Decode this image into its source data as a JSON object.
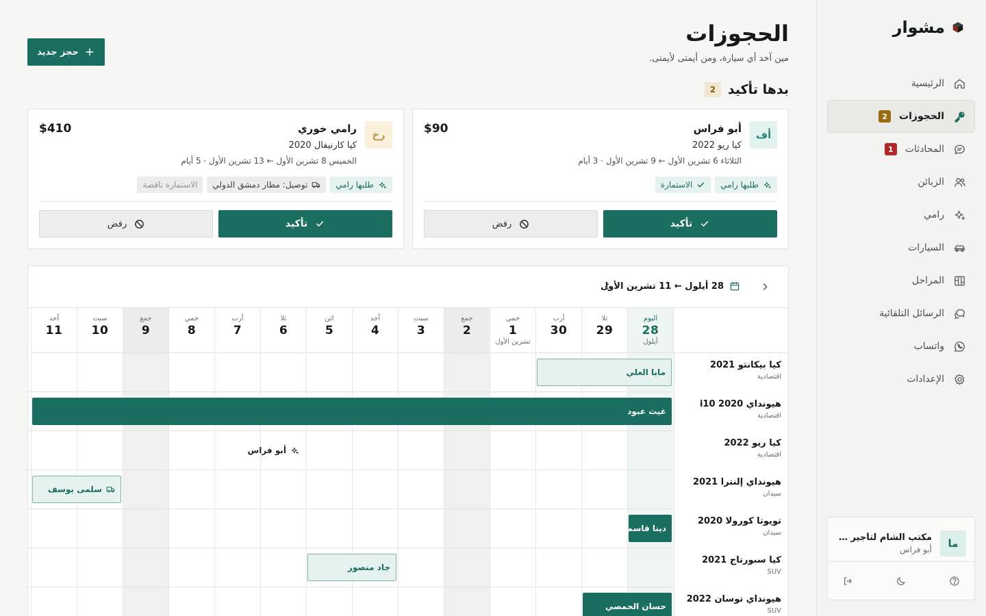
{
  "app": {
    "brand": "مشوار"
  },
  "nav": [
    {
      "label": "الرئيسية",
      "icon": "home-icon"
    },
    {
      "label": "الحجوزات",
      "icon": "key-icon",
      "badge": "2",
      "active": true
    },
    {
      "label": "المحادثات",
      "icon": "chat-icon",
      "badge": "1"
    },
    {
      "label": "الزبائن",
      "icon": "users-icon"
    },
    {
      "label": "رامي",
      "icon": "sparkle-icon"
    },
    {
      "label": "السيارات",
      "icon": "car-icon"
    },
    {
      "label": "المراحل",
      "icon": "kanban-icon"
    },
    {
      "label": "الرسائل التلقائية",
      "icon": "messages-icon"
    },
    {
      "label": "واتساب",
      "icon": "whatsapp-icon"
    },
    {
      "label": "الإعدادات",
      "icon": "gear-icon"
    }
  ],
  "org": {
    "avatar": "ما",
    "name": "مكتب الشام لتأجير السيارات",
    "user": "أبو فراس"
  },
  "page": {
    "title": "الحجوزات",
    "subtitle": "مين آخد أي سيارة، ومن أيمتى لأيمتى.",
    "new_booking": "حجز جديد"
  },
  "pending": {
    "title": "بدها تأكيد",
    "count": "2",
    "cards": [
      {
        "initials": "أف",
        "name": "أبو فراس",
        "car": "كيا ريو 2022",
        "dates": "الثلاثاء 6 تشرين الأول ← 9 تشرين الأول · 3 أيام",
        "price": "$90",
        "tags": [
          {
            "label": "طلبها رامي",
            "icon": "sparkle-icon",
            "style": "teal"
          },
          {
            "label": "الاستمارة",
            "icon": "check-icon",
            "style": "teal"
          }
        ],
        "confirm": "تأكيد",
        "reject": "رفض"
      },
      {
        "initials": "رخ",
        "name": "رامي خوري",
        "car": "كيا كارنيفال 2020",
        "dates": "الخميس 8 تشرين الأول ← 13 تشرين الأول · 5 أيام",
        "price": "$410",
        "tags": [
          {
            "label": "طلبها رامي",
            "icon": "sparkle-icon",
            "style": "teal"
          },
          {
            "label": "توصيل: مطار دمشق الدولي",
            "icon": "truck-icon",
            "style": "gray"
          },
          {
            "label": "الاستمارة ناقصة",
            "icon": "",
            "style": "muted"
          }
        ],
        "confirm": "تأكيد",
        "reject": "رفض"
      }
    ]
  },
  "calendar": {
    "range": "28 أيلول ← 11 تشرين الأول",
    "days": [
      {
        "dn": "اليوم",
        "dd": "28",
        "dm": "أيلول",
        "today": true
      },
      {
        "dn": "ثلا",
        "dd": "29",
        "dm": ""
      },
      {
        "dn": "أرب",
        "dd": "30",
        "dm": ""
      },
      {
        "dn": "خمي",
        "dd": "1",
        "dm": "تشرين الأول"
      },
      {
        "dn": "جمع",
        "dd": "2",
        "dm": "",
        "weekend": true
      },
      {
        "dn": "سبت",
        "dd": "3",
        "dm": ""
      },
      {
        "dn": "أحد",
        "dd": "4",
        "dm": ""
      },
      {
        "dn": "اثن",
        "dd": "5",
        "dm": ""
      },
      {
        "dn": "ثلا",
        "dd": "6",
        "dm": ""
      },
      {
        "dn": "أرب",
        "dd": "7",
        "dm": ""
      },
      {
        "dn": "خمي",
        "dd": "8",
        "dm": ""
      },
      {
        "dn": "جمع",
        "dd": "9",
        "dm": "",
        "weekend": true
      },
      {
        "dn": "سبت",
        "dd": "10",
        "dm": ""
      },
      {
        "dn": "أحد",
        "dd": "11",
        "dm": ""
      }
    ],
    "rows": [
      {
        "car": "كيا بيكانتو 2021",
        "cls": "اقتصادية",
        "bookings": [
          {
            "name": "مايا العلي",
            "start": 0,
            "end": 2,
            "style": "light"
          }
        ]
      },
      {
        "car": "هيونداي i10 2020",
        "cls": "اقتصادية",
        "bookings": [
          {
            "name": "غيث عبود",
            "start": 0,
            "end": 13,
            "style": "solid"
          }
        ]
      },
      {
        "car": "كيا ريو 2022",
        "cls": "اقتصادية",
        "bookings": [
          {
            "name": "أبو فراس",
            "start": 8,
            "end": 10,
            "style": "pending",
            "icon": "sparkle-icon"
          }
        ]
      },
      {
        "car": "هيونداي إلنترا 2021",
        "cls": "سيدان",
        "bookings": [
          {
            "name": "سلمى يوسف",
            "start": 12,
            "end": 13,
            "style": "light",
            "icon": "truck-icon"
          }
        ]
      },
      {
        "car": "تويوتا كورولا 2020",
        "cls": "سيدان",
        "bookings": [
          {
            "name": "دينا قاسم",
            "start": 0,
            "end": 0,
            "style": "solid"
          }
        ]
      },
      {
        "car": "كيا سبورتاج 2021",
        "cls": "SUV",
        "bookings": [
          {
            "name": "جاد منصور",
            "start": 6,
            "end": 7,
            "style": "light"
          }
        ]
      },
      {
        "car": "هيونداي توسان 2022",
        "cls": "SUV",
        "bookings": [
          {
            "name": "حسان الحمصي",
            "start": 0,
            "end": 1,
            "style": "solid"
          }
        ]
      }
    ]
  }
}
